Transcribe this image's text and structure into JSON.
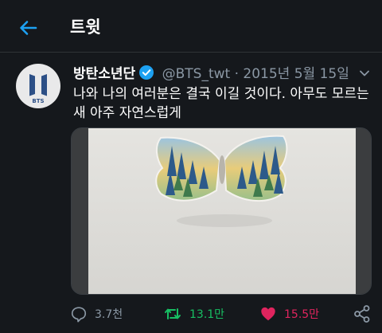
{
  "header": {
    "title": "트윗"
  },
  "tweet": {
    "display_name": "방탄소년단",
    "handle": "@BTS_twt",
    "separator": "·",
    "date": "2015년 5월 15일",
    "text": "나와 나의 여러분은 결국 이길 것이다. 아무도 모르는\n새 아주 자연스럽게",
    "avatar_logo_text": "BTS"
  },
  "actions": {
    "reply_count": "3.7천",
    "retweet_count": "13.1만",
    "like_count": "15.5만"
  },
  "colors": {
    "background": "#15181c",
    "accent": "#1da1f2",
    "secondary_text": "#8b98a5",
    "retweet_active": "#17bf63",
    "like_active": "#e0245e"
  },
  "icons": [
    "back-arrow-icon",
    "verified-badge-icon",
    "chevron-down-icon",
    "reply-icon",
    "retweet-icon",
    "like-icon",
    "share-icon"
  ]
}
